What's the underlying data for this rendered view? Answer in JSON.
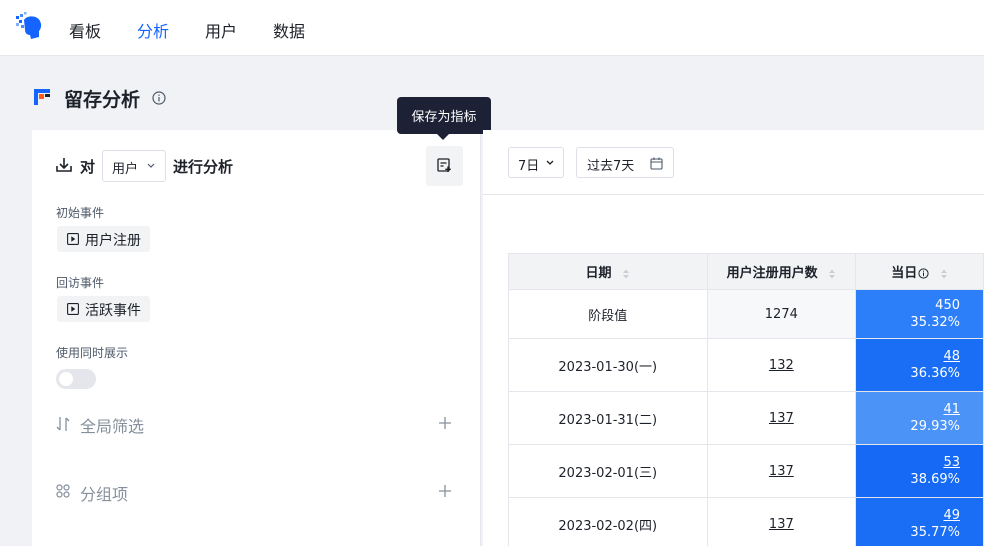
{
  "nav": {
    "items": [
      "看板",
      "分析",
      "用户",
      "数据"
    ],
    "active_index": 1,
    "accent_color": "#1664ff"
  },
  "page": {
    "title": "留存分析"
  },
  "tooltip": {
    "text": "保存为指标"
  },
  "left": {
    "dui_label": "对",
    "subject_select": "用户",
    "analyze_label": "进行分析",
    "initial_event_label": "初始事件",
    "initial_event": "用户注册",
    "return_event_label": "回访事件",
    "return_event": "活跃事件",
    "simultaneous_label": "使用同时展示",
    "simultaneous_on": false,
    "global_filter_label": "全局筛选",
    "group_by_label": "分组项"
  },
  "right": {
    "days_select": "7日",
    "date_range": "过去7天"
  },
  "table": {
    "headers": [
      "日期",
      "用户注册用户数",
      "当日"
    ],
    "stage_row": {
      "label": "阶段值",
      "count": "1274",
      "day_value": "450",
      "day_pct": "35.32%",
      "color": "#2d7ff9"
    },
    "rows": [
      {
        "date": "2023-01-30(一)",
        "count": "132",
        "day_value": "48",
        "day_pct": "36.36%",
        "color": "#1a6ef5"
      },
      {
        "date": "2023-01-31(二)",
        "count": "137",
        "day_value": "41",
        "day_pct": "29.93%",
        "color": "#4b93f7"
      },
      {
        "date": "2023-02-01(三)",
        "count": "137",
        "day_value": "53",
        "day_pct": "38.69%",
        "color": "#1669f4"
      },
      {
        "date": "2023-02-02(四)",
        "count": "137",
        "day_value": "49",
        "day_pct": "35.77%",
        "color": "#1a6ef5"
      }
    ]
  }
}
